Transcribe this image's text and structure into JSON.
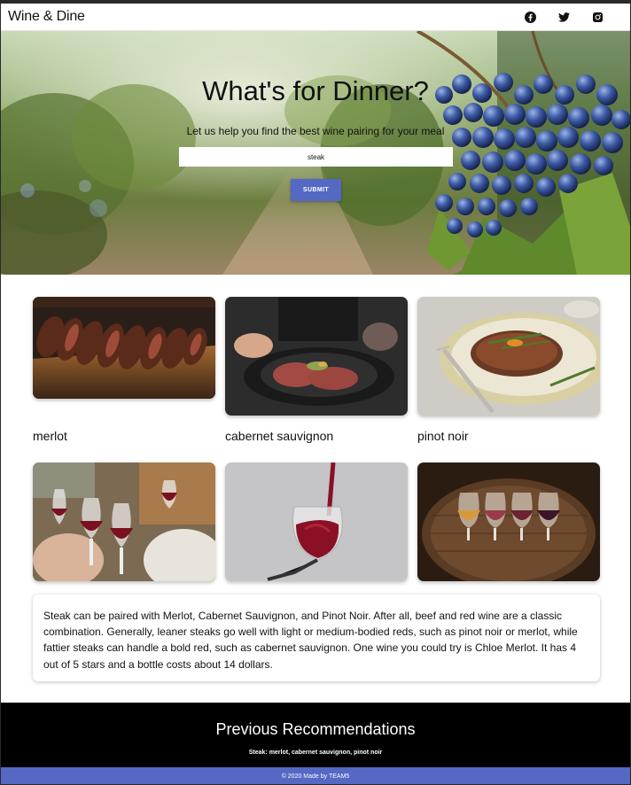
{
  "navbar": {
    "brand": "Wine & Dine",
    "socials": [
      {
        "icon": "facebook-icon"
      },
      {
        "icon": "twitter-icon"
      },
      {
        "icon": "instagram-icon"
      }
    ]
  },
  "hero": {
    "title": "What's for Dinner?",
    "subtitle": "Let us help you find the best wine pairing for your meal",
    "search_value": "steak",
    "submit_label": "SUBMIT"
  },
  "food_cards": [
    {
      "image": "sliced steak on board",
      "label": "merlot"
    },
    {
      "image": "steak on black plate",
      "label": "cabernet sauvignon"
    },
    {
      "image": "steak with rosemary on plate",
      "label": "pinot noir"
    }
  ],
  "wine_images": [
    {
      "image": "friends toasting red wine"
    },
    {
      "image": "red wine pouring into glass"
    },
    {
      "image": "wine glasses on barrel"
    }
  ],
  "description": "Steak can be paired with Merlot, Cabernet Sauvignon, and Pinot Noir. After all, beef and red wine are a classic combination. Generally, leaner steaks go well with light or medium-bodied reds, such as pinot noir or merlot, while fattier steaks can handle a bold red, such as cabernet sauvignon. One wine you could try is Chloe Merlot. It has 4 out of 5 stars and a bottle costs about 14 dollars.",
  "previous": {
    "title": "Previous Recommendations",
    "items": [
      "Steak: merlot, cabernet sauvignon, pinot noir"
    ]
  },
  "footer": {
    "text": "© 2020 Made by TEAM5"
  },
  "colors": {
    "accent": "#5468c4",
    "dark_band": "#000000"
  }
}
